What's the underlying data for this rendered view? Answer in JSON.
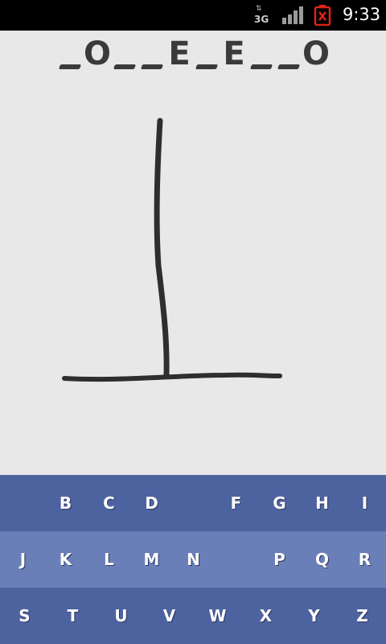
{
  "status_bar": {
    "network": "3G",
    "network_arrows": "⇅",
    "time": "9:33"
  },
  "word": {
    "slots": [
      "",
      "O",
      "",
      "",
      "E",
      "",
      "E",
      "",
      "",
      "O"
    ]
  },
  "keyboard": {
    "rows": [
      [
        "",
        "B",
        "C",
        "D",
        "",
        "F",
        "G",
        "H",
        "I"
      ],
      [
        "J",
        "K",
        "L",
        "M",
        "N",
        "",
        "P",
        "Q",
        "R"
      ],
      [
        "S",
        "T",
        "U",
        "V",
        "W",
        "X",
        "Y",
        "Z"
      ]
    ]
  },
  "colors": {
    "keyboard_row_dark": "#4d63a0",
    "keyboard_row_light": "#6a7fb8",
    "background": "#e8e8e8",
    "ink": "#3a3a3a",
    "battery_alert": "#e0231b"
  }
}
